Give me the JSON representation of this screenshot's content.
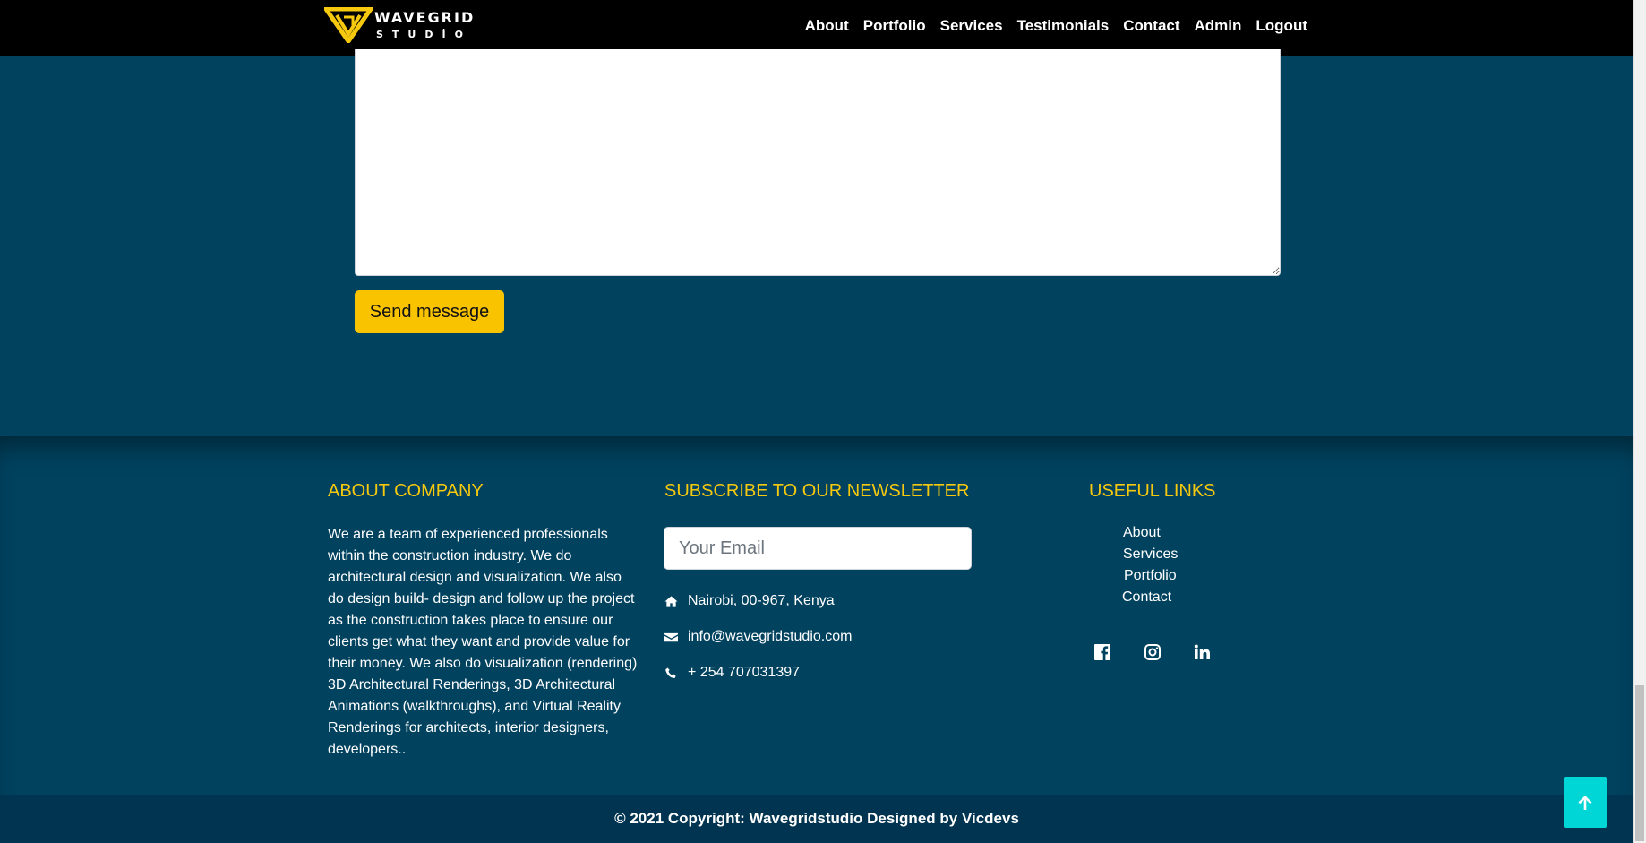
{
  "brand": {
    "name_line1": "WAVEGRID",
    "name_line2": "STUDİO",
    "logo_color": "#f6c90e"
  },
  "nav": {
    "items": [
      {
        "label": "About"
      },
      {
        "label": "Portfolio"
      },
      {
        "label": "Services"
      },
      {
        "label": "Testimonials"
      },
      {
        "label": "Contact"
      },
      {
        "label": "Admin"
      },
      {
        "label": "Logout"
      }
    ]
  },
  "contact_form": {
    "message_value": "",
    "send_label": "Send message"
  },
  "footer": {
    "about": {
      "title": "ABOUT COMPANY",
      "text": "We are a team of experienced professionals within the construction industry. We do architectural design and visualization. We also do design build- design and follow up the project as the construction takes place to ensure our clients get what they want and provide value for their money. We also do visualization (rendering) 3D Architectural Renderings, 3D Architectural Animations (walkthroughs), and Virtual Reality Renderings for architects, interior designers, developers.."
    },
    "newsletter": {
      "title": "SUBSCRIBE TO OUR NEWSLETTER",
      "email_placeholder": "Your Email",
      "address": "Nairobi, 00-967, Kenya",
      "email": "info@wavegridstudio.com",
      "phone": "+ 254 707031397"
    },
    "links": {
      "title": "USEFUL LINKS",
      "items": [
        "About",
        "Services",
        "Portfolio",
        "Contact"
      ]
    },
    "social": [
      "facebook-icon",
      "instagram-icon",
      "linkedin-icon"
    ]
  },
  "copyright": "© 2021 Copyright: Wavegridstudio Designed by Vicdevs",
  "colors": {
    "background": "#01425f",
    "accent": "#f6c90e",
    "button": "#f9c300",
    "back_to_top": "#00d6d6",
    "copyright_bar": "#003450"
  }
}
